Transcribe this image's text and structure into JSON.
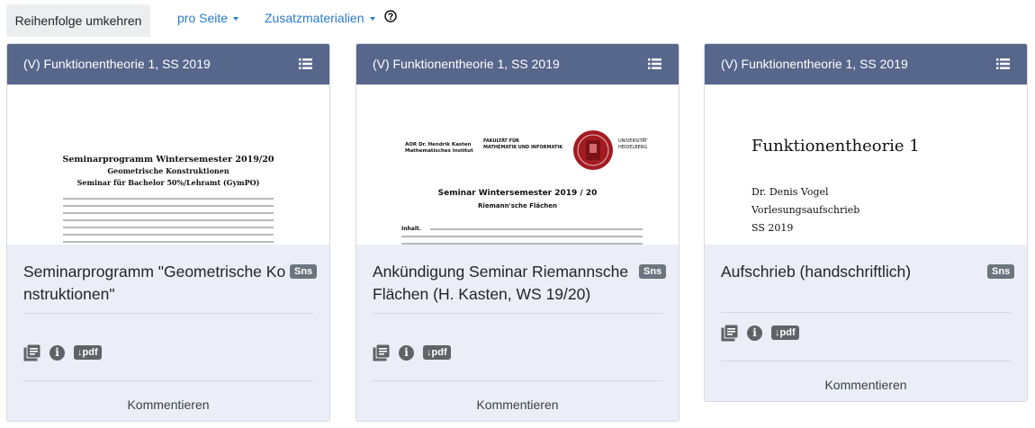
{
  "toolbar": {
    "reverse_label": "Reihenfolge umkehren",
    "per_page_label": "pro Seite",
    "materials_label": "Zusatzmaterialien"
  },
  "cards": [
    {
      "header": "(V) Funktionentheorie 1, SS 2019",
      "title_line1": "Seminarprogramm \"Geometrische Ko",
      "title_line2": "nstruktionen\"",
      "badge": "Sns",
      "pdf_label": "↓pdf",
      "comment_label": "Kommentieren",
      "preview": {
        "heading": "Seminarprogramm Wintersemester 2019/20",
        "sub1": "Geometrische Konstruktionen",
        "sub2": "Seminar für Bachelor 50%/Lehramt (GymPO)"
      }
    },
    {
      "header": "(V) Funktionentheorie 1, SS 2019",
      "title_line1": "Ankündigung Seminar Riemannsche",
      "title_line2": "Flächen (H. Kasten, WS 19/20)",
      "badge": "Sns",
      "pdf_label": "↓pdf",
      "comment_label": "Kommentieren",
      "preview": {
        "author1": "AOR Dr. Hendrik Kasten",
        "author2": "Mathematisches Institut",
        "faculty1": "FAKULTÄT FÜR",
        "faculty2": "MATHEMATIK UND INFORMATIK",
        "uni1": "UNIVERSITÄT",
        "uni2": "HEIDELBERG",
        "heading": "Seminar Wintersemester 2019 / 20",
        "sub": "Riemann'sche Flächen",
        "inhalt": "Inhalt."
      }
    },
    {
      "header": "(V) Funktionentheorie 1, SS 2019",
      "title_line1": "Aufschrieb (handschriftlich)",
      "badge": "Sns",
      "pdf_label": "↓pdf",
      "comment_label": "Kommentieren",
      "preview": {
        "heading": "Funktionentheorie 1",
        "line1": "Dr. Denis Vogel",
        "line2": "Vorlesungsaufschrieb",
        "line3": "SS 2019"
      }
    }
  ],
  "colors": {
    "header_bg": "#57678b",
    "body_bg": "#ebeef6",
    "link": "#2a7ad2",
    "badge": "#6c757d"
  },
  "icons": [
    "chevron-down-icon",
    "help-circle-icon",
    "list-menu-icon",
    "copy-collection-icon",
    "info-icon",
    "download-pdf-badge",
    "university-seal-logo"
  ]
}
